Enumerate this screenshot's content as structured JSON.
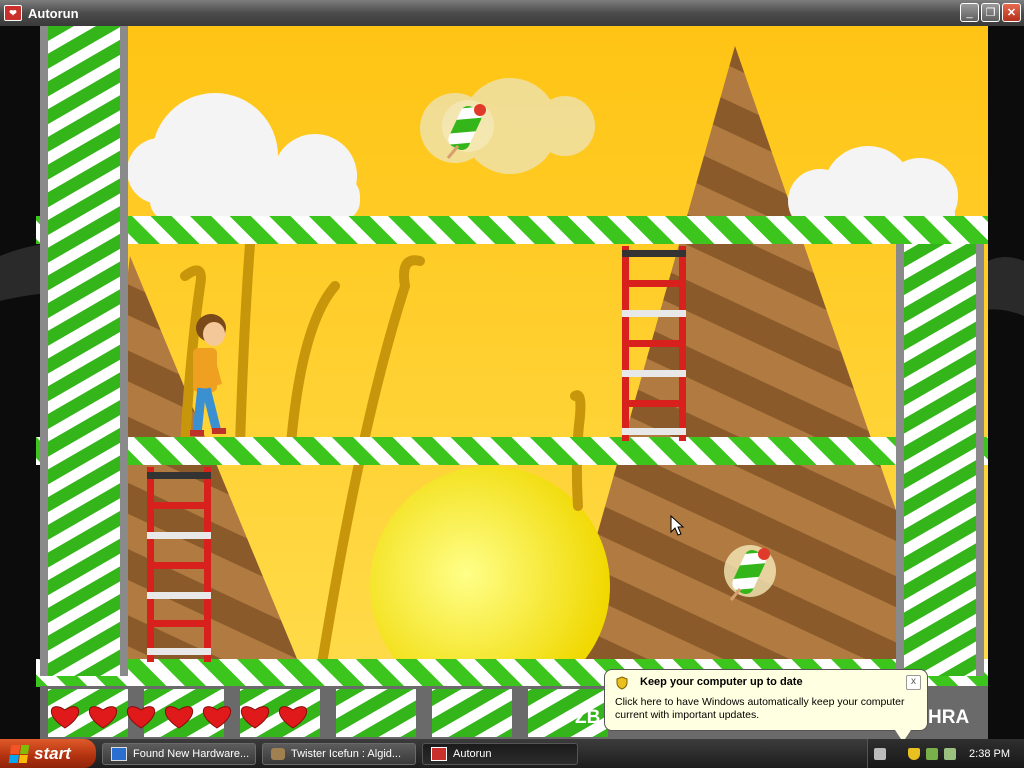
{
  "window": {
    "title": "Autorun",
    "icon": "autorun-icon",
    "controls": [
      "minimize-icon",
      "restore-icon",
      "close-icon"
    ]
  },
  "game": {
    "hud": {
      "lives": 7,
      "left_text": "ZB",
      "right_text": "HRA"
    }
  },
  "notification": {
    "title": "Keep your computer up to date",
    "body": "Click here to have Windows automatically keep your computer current with important updates.",
    "close_label": "x"
  },
  "taskbar": {
    "start_label": "start",
    "tasks": [
      {
        "label": "Found New Hardware...",
        "icon": "hardware-icon",
        "active": false
      },
      {
        "label": "Twister Icefun : Algid...",
        "icon": "game-icon",
        "active": false
      },
      {
        "label": "Autorun",
        "icon": "autorun-icon",
        "active": true
      }
    ],
    "clock": "2:38 PM"
  },
  "colors": {
    "sky": "#f8c21a",
    "stripe_green": "#3cc51c",
    "stripe_white": "#ffffff",
    "ladder_red": "#d8201c",
    "heart_red": "#e01a1a",
    "balloon_bg": "#ffffe1",
    "start_orange": "#d0461c"
  }
}
